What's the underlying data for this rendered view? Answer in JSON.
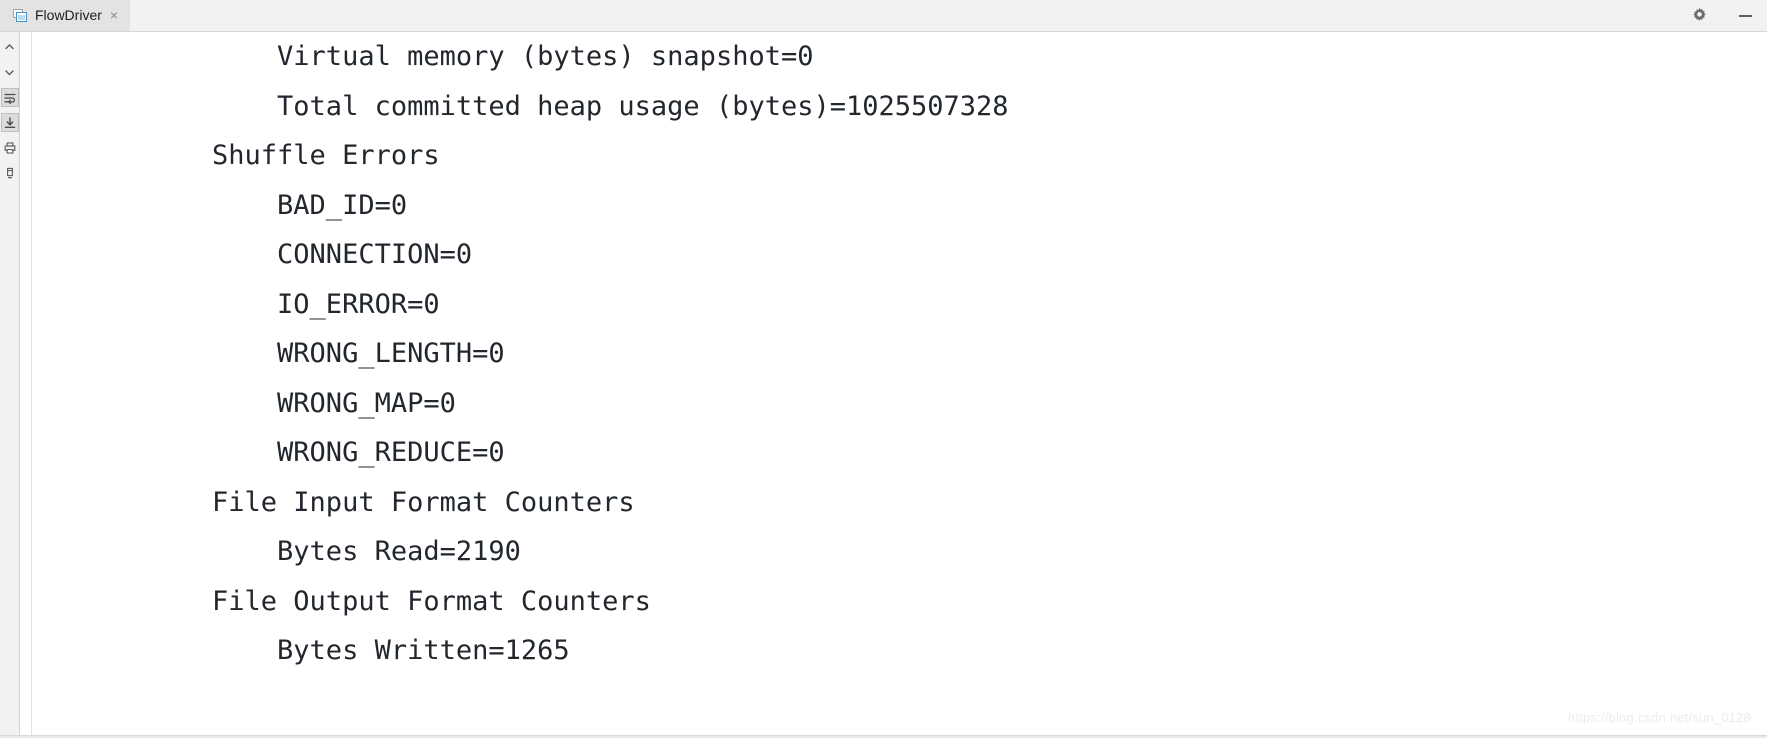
{
  "window": {
    "tab": {
      "label": "FlowDriver",
      "close_label": "×",
      "icon": "console-window-icon"
    },
    "controls": {
      "settings_label": "gear-icon",
      "minimize_label": "minimize-icon"
    }
  },
  "side_toolbar": {
    "items": [
      {
        "name": "scroll-up-icon",
        "pressed": false
      },
      {
        "name": "scroll-down-icon",
        "pressed": false
      },
      {
        "name": "soft-wrap-icon",
        "pressed": true
      },
      {
        "name": "scroll-to-end-icon",
        "pressed": true
      },
      {
        "name": "print-icon",
        "pressed": false
      },
      {
        "name": "clear-all-icon",
        "pressed": false
      }
    ]
  },
  "console": {
    "lines": [
      "        Virtual memory (bytes) snapshot=0",
      "        Total committed heap usage (bytes)=1025507328",
      "    Shuffle Errors",
      "        BAD_ID=0",
      "        CONNECTION=0",
      "        IO_ERROR=0",
      "        WRONG_LENGTH=0",
      "        WRONG_MAP=0",
      "        WRONG_REDUCE=0",
      "    File Input Format Counters",
      "        Bytes Read=2190",
      "    File Output Format Counters",
      "        Bytes Written=1265"
    ]
  },
  "watermark": {
    "text": "https://blog.csdn.net/sun_0128"
  },
  "colors": {
    "tab_active_bg": "#e3e3e3",
    "chrome_bg": "#f2f2f2",
    "console_bg": "#ffffff",
    "console_text": "#22272e",
    "tab_icon_accent": "#4a90c4"
  }
}
